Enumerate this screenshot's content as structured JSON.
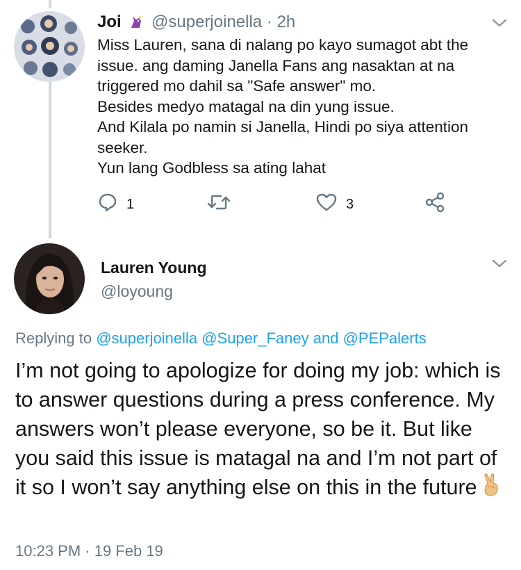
{
  "reply": {
    "author_name": "Joi",
    "author_emoji": "unicorn-emoji",
    "handle": "@superjoinella",
    "separator": "·",
    "time": "2h",
    "text": "Miss Lauren, sana di nalang po kayo sumagot abt the issue. ang daming Janella Fans ang nasaktan at na triggered mo dahil sa \"Safe answer\" mo.\nBesides medyo matagal na din yung issue.\nAnd Kilala po namin si Janella, Hindi po siya attention seeker.\nYun lang Godbless sa ating lahat",
    "actions": {
      "reply_count": "1",
      "retweet_count": "",
      "like_count": "3"
    }
  },
  "tweet": {
    "author_name": "Lauren Young",
    "handle": "@loyoung",
    "replying_prefix": "Replying to",
    "replying_to": [
      "@superjoinella",
      "@Super_Faney",
      "@PEPalerts"
    ],
    "replying_and": "and",
    "text": "I’m not going to apologize for doing my job: which is to answer questions during a press conference. My answers won’t please everyone, so be it. But like you said this issue is matagal na and I’m not part of it so I won’t say anything else on this in the future",
    "emoji": "victory-hand-emoji",
    "timestamp": "10:23 PM · 19 Feb 19"
  },
  "colors": {
    "link": "#1da1f2",
    "secondary_text": "#657786",
    "primary_text": "#14171a",
    "thread_line": "#cfd9de"
  }
}
